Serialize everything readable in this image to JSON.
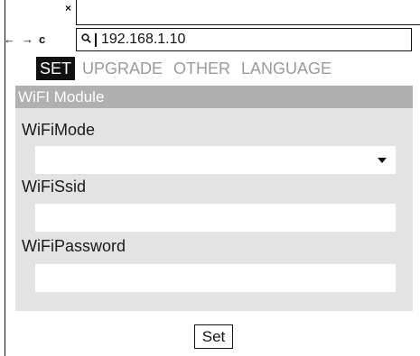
{
  "browser": {
    "tab_close": "×",
    "back_glyph": "←",
    "forward_glyph": "→",
    "reload_glyph": "c",
    "search_icon": "search-icon",
    "url": "192.168.1.10"
  },
  "nav": {
    "items": [
      {
        "label": "SET",
        "active": true
      },
      {
        "label": "UPGRADE",
        "active": false
      },
      {
        "label": "OTHER",
        "active": false
      },
      {
        "label": "LANGUAGE",
        "active": false
      }
    ]
  },
  "panel": {
    "title": "WiFI Module",
    "wifi_mode": {
      "label": "WiFiMode",
      "value": ""
    },
    "wifi_ssid": {
      "label": "WiFiSsid",
      "value": ""
    },
    "wifi_password": {
      "label": "WiFiPassword",
      "value": ""
    }
  },
  "actions": {
    "set_label": "Set"
  },
  "colors": {
    "panel_bg": "#e3e3e3",
    "panel_header_bg": "#b0b0b0",
    "nav_inactive": "#9a9a9a",
    "nav_active_bg": "#111111"
  }
}
